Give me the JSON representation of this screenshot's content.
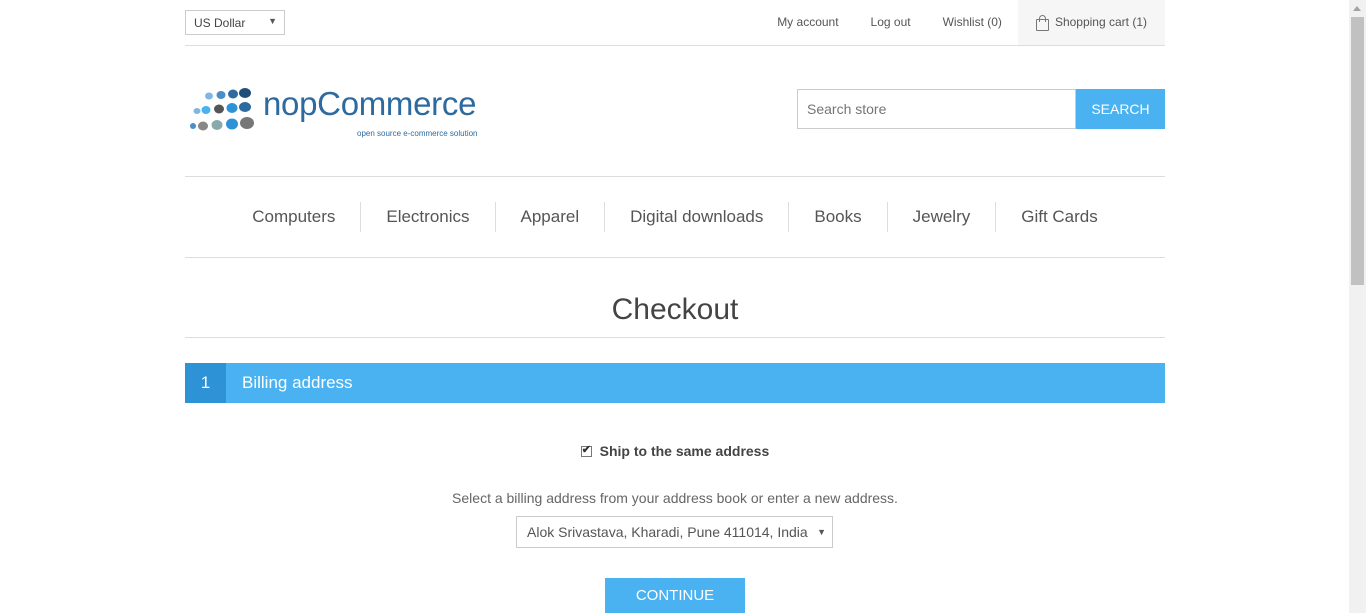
{
  "header": {
    "currency": "US Dollar",
    "links": {
      "my_account": "My account",
      "log_out": "Log out",
      "wishlist": "Wishlist (0)",
      "shopping_cart": "Shopping cart (1)"
    }
  },
  "logo": {
    "name": "nopCommerce",
    "tagline": "open source e-commerce solution"
  },
  "search": {
    "placeholder": "Search store",
    "button": "SEARCH"
  },
  "menu": {
    "items": [
      "Computers",
      "Electronics",
      "Apparel",
      "Digital downloads",
      "Books",
      "Jewelry",
      "Gift Cards"
    ]
  },
  "page": {
    "title": "Checkout"
  },
  "step": {
    "number": "1",
    "title": "Billing address"
  },
  "billing": {
    "ship_same_label": "Ship to the same address",
    "ship_same_checked": true,
    "hint": "Select a billing address from your address book or enter a new address.",
    "selected_address": "Alok Srivastava, Kharadi, Pune 411014, India",
    "continue_button": "CONTINUE"
  },
  "colors": {
    "accent": "#4ab2f1",
    "accent_dark": "#2e93d6",
    "logo_blue": "#2d6a9f"
  }
}
